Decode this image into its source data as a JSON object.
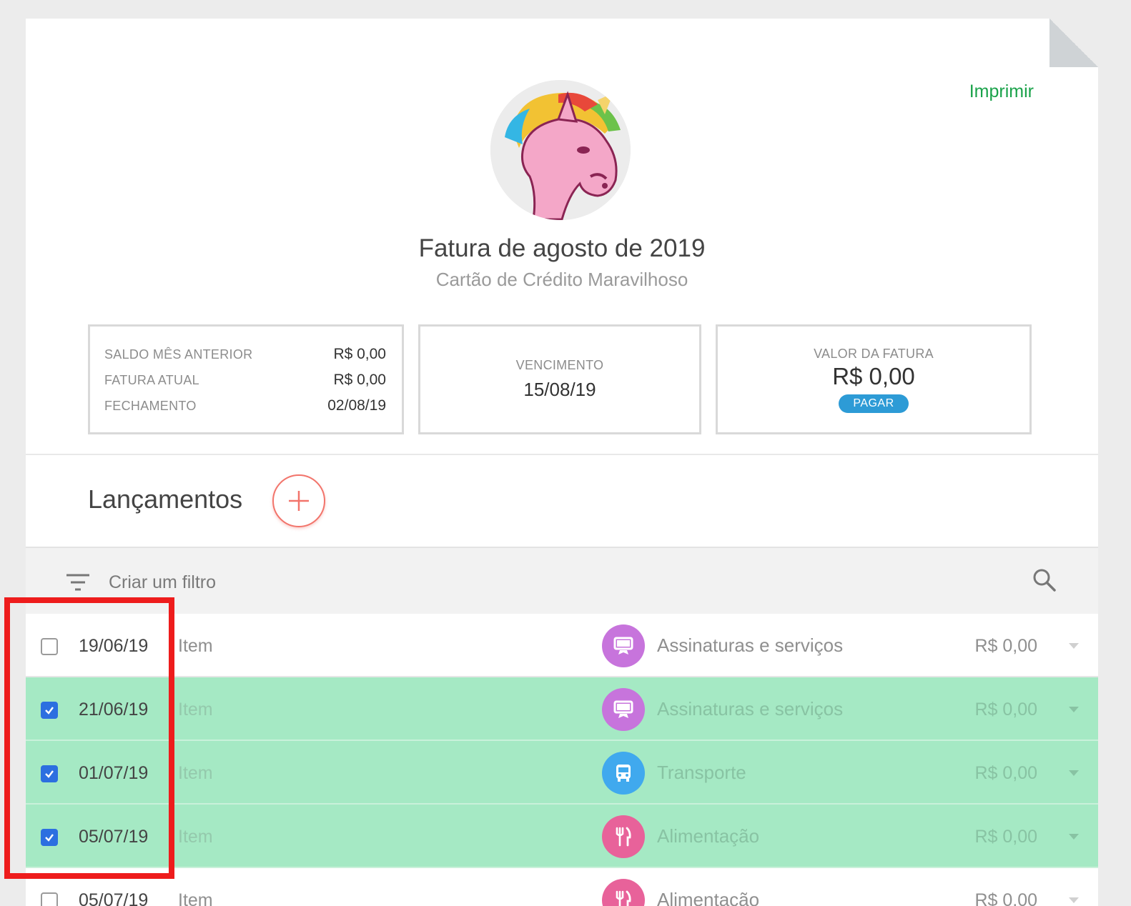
{
  "header": {
    "print_label": "Imprimir",
    "title": "Fatura de agosto de 2019",
    "subtitle": "Cartão de Crédito Maravilhoso"
  },
  "summary": {
    "left_box": [
      {
        "label": "SALDO MÊS ANTERIOR",
        "value": "R$ 0,00"
      },
      {
        "label": "FATURA ATUAL",
        "value": "R$ 0,00"
      },
      {
        "label": "FECHAMENTO",
        "value": "02/08/19"
      }
    ],
    "due_label": "VENCIMENTO",
    "due_value": "15/08/19",
    "invoice_label": "VALOR DA FATURA",
    "invoice_value": "R$ 0,00",
    "pay_label": "PAGAR"
  },
  "transactions_section": {
    "title": "Lançamentos",
    "filter_placeholder": "Criar um filtro"
  },
  "transactions": [
    {
      "checked": false,
      "date": "19/06/19",
      "description": "Item",
      "category": "Assinaturas e serviços",
      "category_icon": "monitor-icon",
      "category_color": "#c774dc",
      "amount": "R$ 0,00"
    },
    {
      "checked": true,
      "date": "21/06/19",
      "description": "Item",
      "category": "Assinaturas e serviços",
      "category_icon": "monitor-icon",
      "category_color": "#c774dc",
      "amount": "R$ 0,00"
    },
    {
      "checked": true,
      "date": "01/07/19",
      "description": "Item",
      "category": "Transporte",
      "category_icon": "bus-icon",
      "category_color": "#40a9ee",
      "amount": "R$ 0,00"
    },
    {
      "checked": true,
      "date": "05/07/19",
      "description": "Item",
      "category": "Alimentação",
      "category_icon": "fork-knife-icon",
      "category_color": "#e8629a",
      "amount": "R$ 0,00"
    },
    {
      "checked": false,
      "date": "05/07/19",
      "description": "Item",
      "category": "Alimentação",
      "category_icon": "fork-knife-icon",
      "category_color": "#e8629a",
      "amount": "R$ 0,00"
    }
  ],
  "colors": {
    "accent_green": "#1aa24a",
    "pay_blue": "#2d9bd6",
    "add_red": "#f2746b",
    "selected_row": "#a5e9c4",
    "highlight_red": "#ee1c1c"
  }
}
